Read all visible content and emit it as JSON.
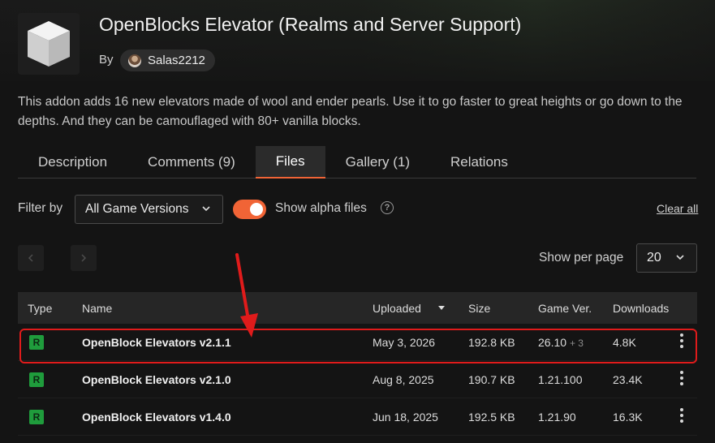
{
  "project": {
    "title": "OpenBlocks Elevator (Realms and Server Support)",
    "by_label": "By",
    "author": "Salas2212",
    "description": "This addon adds 16 new elevators made of wool and ender pearls. Use it to go faster to great heights or go down to the depths. And they can be camouflaged with 80+ vanilla blocks."
  },
  "tabs": [
    {
      "label": "Description",
      "active": false
    },
    {
      "label": "Comments (9)",
      "active": false
    },
    {
      "label": "Files",
      "active": true
    },
    {
      "label": "Gallery (1)",
      "active": false
    },
    {
      "label": "Relations",
      "active": false
    }
  ],
  "filters": {
    "filter_by_label": "Filter by",
    "game_version_selected": "All Game Versions",
    "show_alpha_label": "Show alpha files",
    "show_alpha_enabled": true,
    "clear_all_label": "Clear all"
  },
  "pagination": {
    "prev_icon": "chevron-left-icon",
    "next_icon": "chevron-right-icon",
    "per_page_label": "Show per page",
    "per_page_value": "20"
  },
  "table": {
    "headers": {
      "type": "Type",
      "name": "Name",
      "uploaded": "Uploaded",
      "size": "Size",
      "game_ver": "Game Ver.",
      "downloads": "Downloads"
    },
    "rows": [
      {
        "type": "R",
        "name": "OpenBlock Elevators v2.1.1",
        "uploaded": "May 3, 2026",
        "size": "192.8 KB",
        "game_ver": "26.10",
        "game_ver_extra": "+ 3",
        "downloads": "4.8K"
      },
      {
        "type": "R",
        "name": "OpenBlock Elevators v2.1.0",
        "uploaded": "Aug 8, 2025",
        "size": "190.7 KB",
        "game_ver": "1.21.100",
        "game_ver_extra": "",
        "downloads": "23.4K"
      },
      {
        "type": "R",
        "name": "OpenBlock Elevators v1.4.0",
        "uploaded": "Jun 18, 2025",
        "size": "192.5 KB",
        "game_ver": "1.21.90",
        "game_ver_extra": "",
        "downloads": "16.3K"
      }
    ]
  },
  "colors": {
    "accent": "#f16436",
    "release_badge": "#1f9c3c",
    "highlight": "#e01b1b",
    "background": "#141414"
  }
}
